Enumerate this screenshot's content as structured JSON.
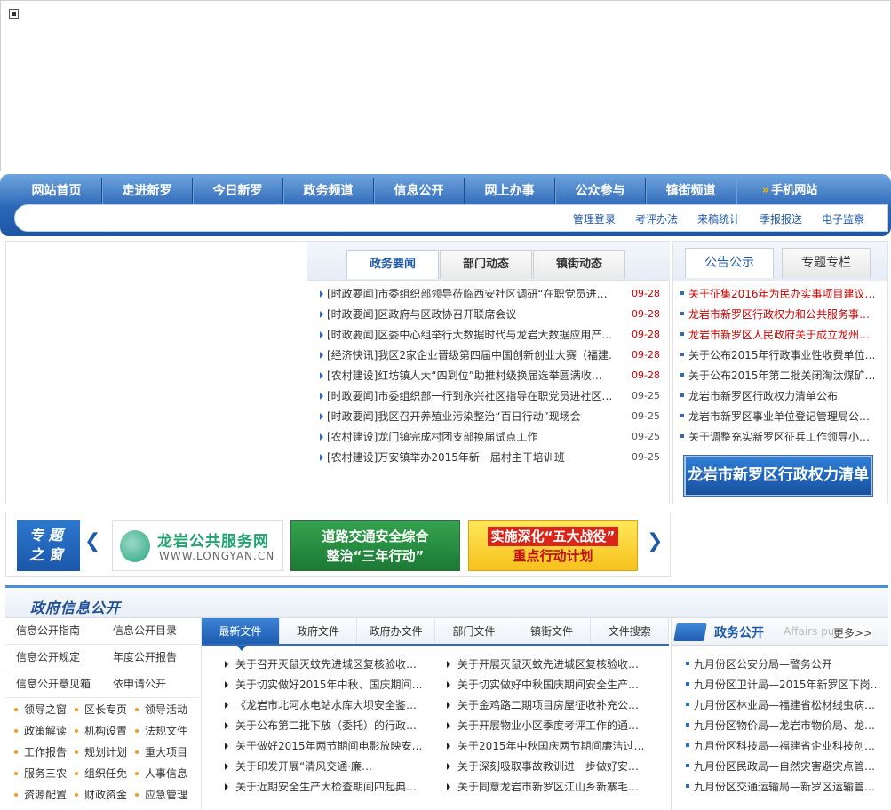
{
  "nav": {
    "items": [
      "网站首页",
      "走进新罗",
      "今日新罗",
      "政务频道",
      "信息公开",
      "网上办事",
      "公众参与",
      "镇街频道"
    ],
    "mobile": "手机网站",
    "links": [
      "管理登录",
      "考评办法",
      "来稿统计",
      "季报报送",
      "电子监察"
    ]
  },
  "news": {
    "tabs": [
      "政务要闻",
      "部门动态",
      "镇街动态"
    ],
    "items": [
      {
        "title": "[时政要闻]市委组织部领导莅临西安社区调研“在职党员进…",
        "date": "09-28"
      },
      {
        "title": "[时政要闻]区政府与区政协召开联席会议",
        "date": "09-28"
      },
      {
        "title": "[时政要闻]区委中心组举行大数据时代与龙岩大数据应用产…",
        "date": "09-28"
      },
      {
        "title": "[经济快讯]我区2家企业晋级第四届中国创新创业大赛（福建…",
        "date": "09-28"
      },
      {
        "title": "[农村建设]红坊镇人大“四到位”助推村级换届选举圆满收…",
        "date": "09-28"
      },
      {
        "title": "[时政要闻]市委组织部一行到永兴社区指导在职党员进社区…",
        "date": "09-25"
      },
      {
        "title": "[时政要闻]我区召开养殖业污染整治“百日行动”现场会",
        "date": "09-25"
      },
      {
        "title": "[农村建设]龙门镇完成村团支部换届试点工作",
        "date": "09-25"
      },
      {
        "title": "[农村建设]万安镇举办2015年新一届村主干培训班",
        "date": "09-25"
      }
    ]
  },
  "notice": {
    "tabs": [
      "公告公示",
      "专题专栏"
    ],
    "items": [
      "关于征集2016年为民办实事项目建议…",
      "龙岩市新罗区行政权力和公共服务事…",
      "龙岩市新罗区人民政府关于成立龙州…",
      "关于公布2015年行政事业性收费单位…",
      "关于公布2015年第二批关闭淘汰煤矿…",
      "龙岩市新罗区行政权力清单公布",
      "龙岩市新罗区事业单位登记管理局公…",
      "关于调整充实新罗区征兵工作领导小…"
    ],
    "power_button": "龙岩市新罗区行政权力清单"
  },
  "special": {
    "label_line1": "专 题",
    "label_line2": "之 窗",
    "prev": "❮",
    "next": "❯",
    "card1_title": "龙岩公共服务网",
    "card1_url": "WWW.LONGYAN.CN",
    "card2_line1": "道路交通安全综合",
    "card2_line2": "整治“三年行动”",
    "card3_line1": "实施深化“五大战役”",
    "card3_line2": "重点行动计划"
  },
  "info": {
    "title": "政府信息公开",
    "left_rows": [
      [
        "信息公开指南",
        "信息公开目录"
      ],
      [
        "信息公开规定",
        "年度公开报告"
      ],
      [
        "信息公开意见箱",
        "依申请公开"
      ]
    ],
    "grid": [
      "领导之窗",
      "区长专页",
      "领导活动",
      "政策解读",
      "机构设置",
      "法规文件",
      "工作报告",
      "规划计划",
      "重大项目",
      "服务三农",
      "组织任免",
      "人事信息",
      "资源配置",
      "财政资金",
      "应急管理"
    ],
    "doc_tabs": [
      "最新文件",
      "政府文件",
      "政府办文件",
      "部门文件",
      "镇街文件",
      "文件搜索"
    ],
    "docs_left": [
      "关于召开灭鼠灭蚊先进城区复核验收…",
      "关于切实做好2015年中秋、国庆期间…",
      "《龙岩市北河水电站水库大坝安全鉴…",
      "关于公布第二批下放（委托）的行政…",
      "关于做好2015年两节期间电影放映安…",
      "关于印发开展“清风交通·廉…",
      "关于近期安全生产大检查期间四起典…"
    ],
    "docs_right": [
      "关于开展灭鼠灭蚊先进城区复核验收…",
      "关于切实做好中秋国庆期间安全生产…",
      "关于金鸡路二期项目房屋征收补充公…",
      "关于开展物业小区季度考评工作的通…",
      "关于2015年中秋国庆两节期间廉洁过…",
      "关于深刻吸取事故教训进一步做好安…",
      "关于同意龙岩市新罗区江山乡新寨毛…"
    ],
    "gov_title": "政务公开",
    "gov_en": "Affairs public",
    "gov_more": "更多>>",
    "gov_items": [
      "九月份区公安分局—警务公开",
      "九月份区卫计局—2015年新罗区下岗…",
      "九月份区林业局—福建省松材线虫病…",
      "九月份区物价局—龙岩市物价局、龙…",
      "九月份区科技局—福建省企业科技创…",
      "九月份区民政局—自然灾害避灾点管…",
      "九月份区交通运输局—新罗区运输管…"
    ]
  }
}
